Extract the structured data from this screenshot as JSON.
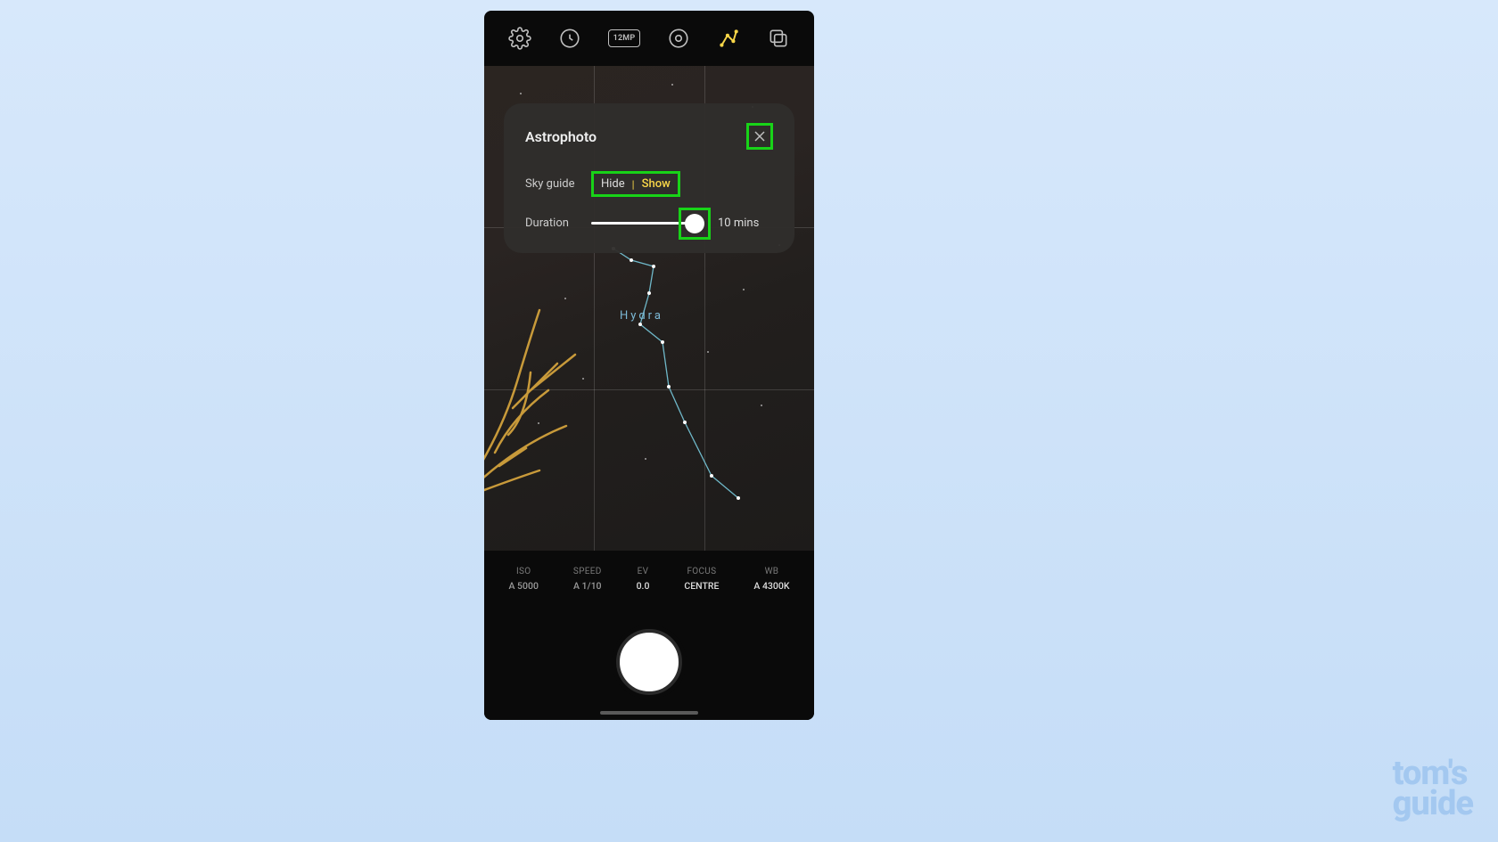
{
  "toolbar": {
    "resolution_badge": "12MP"
  },
  "popup": {
    "title": "Astrophoto",
    "skyguide_label": "Sky guide",
    "skyguide_hide": "Hide",
    "skyguide_show": "Show",
    "duration_label": "Duration",
    "duration_value": "10 mins"
  },
  "constellation": {
    "name": "Hydra"
  },
  "params": [
    {
      "label": "ISO",
      "value": "A 5000"
    },
    {
      "label": "SPEED",
      "value": "A 1/10"
    },
    {
      "label": "EV",
      "value": "0.0"
    },
    {
      "label": "FOCUS",
      "value": "CENTRE"
    },
    {
      "label": "WB",
      "value": "A 4300K"
    }
  ],
  "watermark": {
    "line1": "tom's",
    "line2": "guide"
  }
}
